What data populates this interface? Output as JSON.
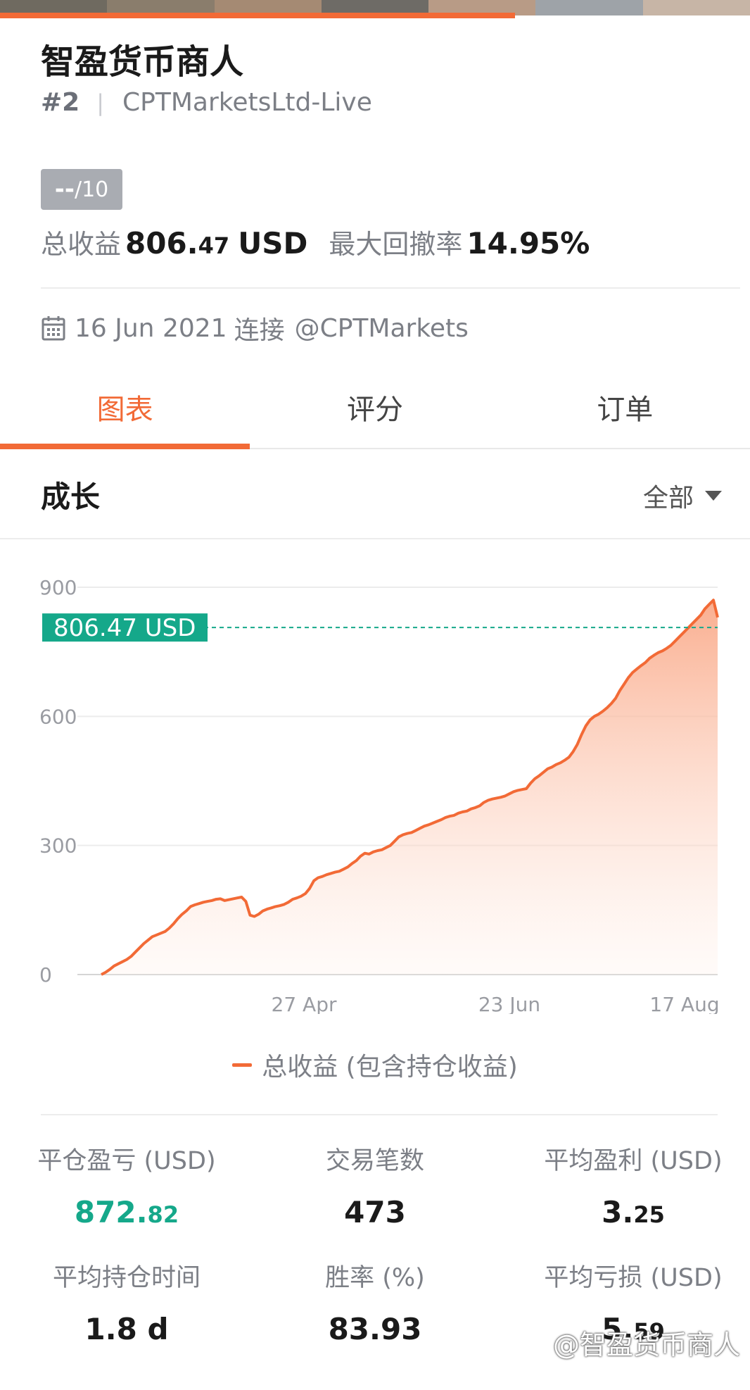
{
  "header": {
    "title": "智盈货币商人",
    "rank": "#2",
    "server": "CPTMarketsLtd-Live",
    "score": {
      "value": "--",
      "suffix": "/10"
    }
  },
  "summary": {
    "total_profit_label": "总收益",
    "total_profit_int": "806.",
    "total_profit_dec": "47",
    "total_profit_unit": "USD",
    "max_drawdown_label": "最大回撤率",
    "max_drawdown_value": "14.95%"
  },
  "connection": {
    "date": "16 Jun 2021",
    "connect_label": "连接",
    "account": "@CPTMarkets"
  },
  "tabs": [
    {
      "label": "图表",
      "active": true
    },
    {
      "label": "评分",
      "active": false
    },
    {
      "label": "订单",
      "active": false
    }
  ],
  "growth": {
    "title": "成长",
    "range": "全部"
  },
  "chart_data": {
    "type": "area",
    "ylim": [
      0,
      900
    ],
    "y_ticks": [
      "900",
      "600",
      "300",
      "0"
    ],
    "x_ticks": [
      "27 Apr",
      "23 Jun",
      "17 Aug"
    ],
    "current_label": "806.47 USD",
    "current_value": 806.47,
    "series": [
      {
        "name": "总收益 (包含持仓收益)",
        "color": "#f26a36",
        "values": [
          0,
          5,
          12,
          20,
          25,
          30,
          35,
          42,
          52,
          62,
          72,
          80,
          88,
          92,
          96,
          100,
          108,
          118,
          130,
          140,
          148,
          158,
          162,
          165,
          168,
          170,
          172,
          175,
          176,
          172,
          174,
          176,
          178,
          180,
          170,
          138,
          135,
          140,
          148,
          152,
          155,
          158,
          160,
          163,
          168,
          175,
          178,
          182,
          188,
          200,
          218,
          225,
          228,
          232,
          235,
          238,
          240,
          245,
          250,
          258,
          265,
          275,
          282,
          280,
          285,
          288,
          290,
          295,
          300,
          310,
          320,
          325,
          328,
          330,
          335,
          340,
          345,
          348,
          352,
          356,
          360,
          365,
          368,
          370,
          375,
          378,
          380,
          385,
          388,
          392,
          400,
          405,
          408,
          410,
          412,
          415,
          420,
          425,
          428,
          430,
          432,
          445,
          455,
          462,
          470,
          478,
          482,
          488,
          492,
          498,
          505,
          518,
          535,
          558,
          578,
          592,
          600,
          605,
          612,
          620,
          630,
          642,
          660,
          675,
          690,
          702,
          710,
          718,
          725,
          735,
          742,
          748,
          752,
          758,
          765,
          775,
          785,
          795,
          805,
          815,
          825,
          835,
          850,
          860,
          870,
          830
        ]
      }
    ]
  },
  "metrics": [
    {
      "label": "平仓盈亏 (USD)",
      "value": "872.",
      "dec": "82",
      "green": true
    },
    {
      "label": "交易笔数",
      "value": "473",
      "dec": "",
      "green": false
    },
    {
      "label": "平均盈利 (USD)",
      "value": "3.",
      "dec": "25",
      "green": false
    },
    {
      "label": "平均持仓时间",
      "value": "1.8 d",
      "dec": "",
      "green": false
    },
    {
      "label": "胜率 (%)",
      "value": "83.93",
      "dec": "",
      "green": false
    },
    {
      "label": "平均亏损 (USD)",
      "value": "5.",
      "dec": "59",
      "green": false
    }
  ],
  "watermark": "@智盈货币商人",
  "colors": {
    "accent": "#f26a36",
    "positive": "#15a88a",
    "muted": "#7c7f86"
  }
}
